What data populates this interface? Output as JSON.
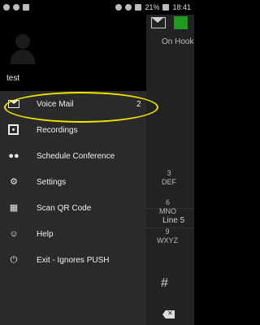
{
  "status_bar": {
    "battery": "21%",
    "time": "18:41"
  },
  "background_app": {
    "on_hook": "On Hook",
    "line5": "Line 5",
    "keys": [
      {
        "num": "3",
        "letters": "DEF"
      },
      {
        "num": "6",
        "letters": "MNO"
      },
      {
        "num": "9",
        "letters": "WXYZ"
      }
    ],
    "hash": "#"
  },
  "drawer": {
    "username": "test",
    "items": [
      {
        "label": "Voice Mail",
        "count": "2",
        "icon": "voicemail-icon"
      },
      {
        "label": "Recordings",
        "icon": "recordings-icon"
      },
      {
        "label": "Schedule Conference",
        "icon": "people-icon"
      },
      {
        "label": "Settings",
        "icon": "gears-icon"
      },
      {
        "label": "Scan QR Code",
        "icon": "qr-code-icon"
      },
      {
        "label": "Help",
        "icon": "help-user-icon"
      },
      {
        "label": "Exit - Ignores PUSH",
        "icon": "power-icon"
      }
    ]
  },
  "colors": {
    "highlight": "#f2e400",
    "on_hook_indicator": "#1f9b24"
  }
}
